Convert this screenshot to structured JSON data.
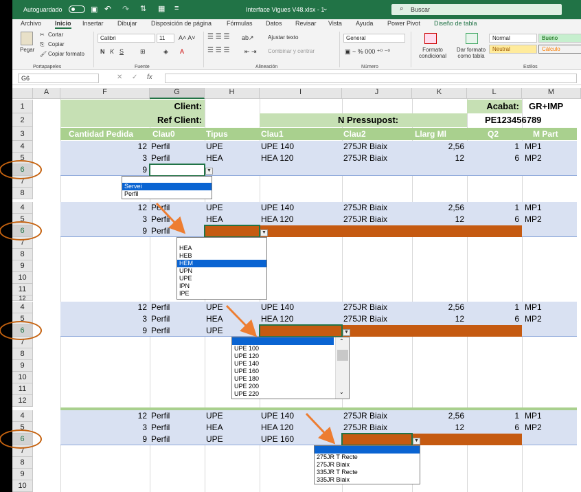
{
  "titlebar": {
    "autosave": "Autoguardado",
    "filename": "Interface Vigues V48.xlsx  -  1",
    "search": "Buscar"
  },
  "tabs": [
    "Archivo",
    "Inicio",
    "Insertar",
    "Dibujar",
    "Disposición de página",
    "Fórmulas",
    "Datos",
    "Revisar",
    "Vista",
    "Ayuda",
    "Power Pivot",
    "Diseño de tabla"
  ],
  "ribbon": {
    "cortar": "Cortar",
    "copiar": "Copiar",
    "copiar_formato": "Copiar formato",
    "pegar": "Pegar",
    "font": "Calibri",
    "size": "11",
    "ajustar": "Ajustar texto",
    "combinar": "Combinar y centrar",
    "numfmt": "General",
    "formato_cond": "Formato condicional",
    "formato_tabla": "Dar formato como tabla",
    "styles": {
      "normal": "Normal",
      "bueno": "Bueno",
      "neutral": "Neutral",
      "calculo": "Cálculo"
    },
    "groups": {
      "portapapeles": "Portapapeles",
      "fuente": "Fuente",
      "alineacion": "Alineación",
      "numero": "Número",
      "estilos": "Estilos"
    }
  },
  "namebox": "G6",
  "fx": "fx",
  "columns": [
    "A",
    "F",
    "G",
    "H",
    "I",
    "J",
    "K",
    "L",
    "M"
  ],
  "top": {
    "client": "Client:",
    "ref": "Ref Client:",
    "pressupost": "N Pressupost:",
    "acabat": "Acabat:",
    "acabat_val": "GR+IMP",
    "num": "PE123456789"
  },
  "header_row": [
    "Cantidad Pedida",
    "Clau0",
    "Tipus",
    "Clau1",
    "Clau2",
    "Llarg Ml",
    "Q2",
    "M Part"
  ],
  "blocks": [
    {
      "rows": [
        "4",
        "5",
        "6",
        "7",
        "8"
      ],
      "r4": [
        "12",
        "Perfil",
        "UPE",
        "UPE 140",
        "275JR Biaix",
        "2,56",
        "1",
        "MP1"
      ],
      "r5": [
        "3",
        "Perfil",
        "HEA",
        "HEA 120",
        "275JR Biaix",
        "12",
        "6",
        "MP2"
      ],
      "r6": [
        "9"
      ],
      "dropdown": [
        "Servei",
        "Perfil"
      ],
      "selected": "Servei"
    },
    {
      "rows": [
        "4",
        "5",
        "6",
        "7",
        "8",
        "9",
        "10",
        "11",
        "12"
      ],
      "r4": [
        "12",
        "Perfil",
        "UPE",
        "UPE 140",
        "275JR Biaix",
        "2,56",
        "1",
        "MP1"
      ],
      "r5": [
        "3",
        "Perfil",
        "HEA",
        "HEA 120",
        "275JR Biaix",
        "12",
        "6",
        "MP2"
      ],
      "r6": [
        "9",
        "Perfil"
      ],
      "dropdown": [
        "HEA",
        "HEB",
        "HEM",
        "UPN",
        "UPE",
        "IPN",
        "IPE"
      ],
      "selected": "HEM"
    },
    {
      "rows": [
        "4",
        "5",
        "6",
        "7",
        "8",
        "9",
        "10",
        "11",
        "12"
      ],
      "r4": [
        "12",
        "Perfil",
        "UPE",
        "UPE 140",
        "275JR Biaix",
        "2,56",
        "1",
        "MP1"
      ],
      "r5": [
        "3",
        "Perfil",
        "HEA",
        "HEA 120",
        "275JR Biaix",
        "12",
        "6",
        "MP2"
      ],
      "r6": [
        "9",
        "Perfil",
        "UPE"
      ],
      "dropdown": [
        "",
        "UPE 100",
        "UPE 120",
        "UPE 140",
        "UPE 160",
        "UPE 180",
        "UPE 200",
        "UPE 220"
      ],
      "selected": ""
    },
    {
      "rows": [
        "4",
        "5",
        "6",
        "7",
        "8",
        "9",
        "10"
      ],
      "r4": [
        "12",
        "Perfil",
        "UPE",
        "UPE 140",
        "275JR Biaix",
        "2,56",
        "1",
        "MP1"
      ],
      "r5": [
        "3",
        "Perfil",
        "HEA",
        "HEA 120",
        "275JR Biaix",
        "12",
        "6",
        "MP2"
      ],
      "r6": [
        "9",
        "Perfil",
        "UPE",
        "UPE 160"
      ],
      "dropdown": [
        "",
        "275JR T Recte",
        "275JR Biaix",
        "335JR  T Recte",
        "335JR Biaix"
      ],
      "selected": ""
    }
  ],
  "rownums": {
    "r1": "1",
    "r2": "2",
    "r3": "3"
  },
  "colors": {
    "excel_green": "#217346",
    "header_green": "#a9d08e",
    "label_green": "#c6e0b4",
    "band_blue": "#d9e1f2",
    "orange": "#c55a11",
    "ring": "#c5620f",
    "select": "#0a64d2"
  }
}
